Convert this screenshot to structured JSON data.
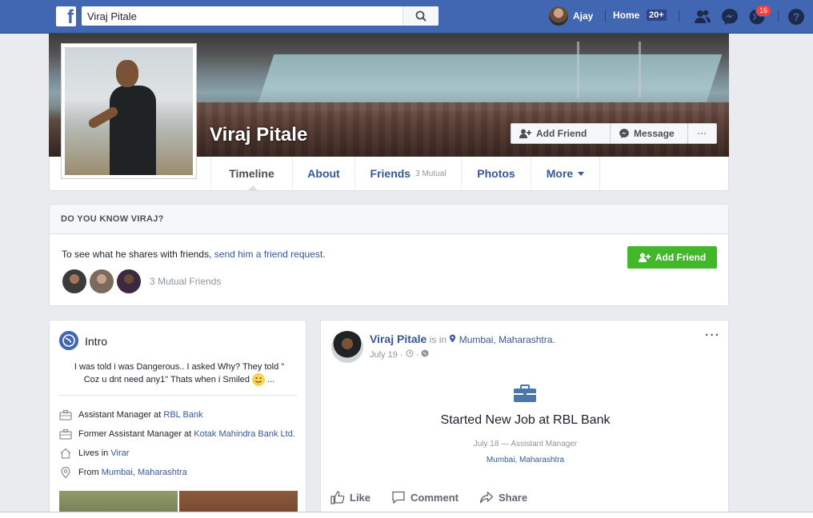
{
  "topbar": {
    "search_value": "Viraj Pitale",
    "user_name": "Ajay",
    "home_label": "Home",
    "home_count": "20+",
    "notifications_count": "16",
    "icons": [
      "facebook-logo-icon",
      "search-icon",
      "friend-requests-icon",
      "messenger-icon",
      "notifications-globe-icon",
      "help-icon"
    ]
  },
  "profile": {
    "name": "Viraj Pitale",
    "add_friend_label": "Add Friend",
    "message_label": "Message",
    "more_label": "···",
    "tabs": [
      {
        "label": "Timeline"
      },
      {
        "label": "About"
      },
      {
        "label": "Friends",
        "sub": "3 Mutual"
      },
      {
        "label": "Photos"
      },
      {
        "label": "More"
      }
    ]
  },
  "know": {
    "heading": "DO YOU KNOW VIRAJ?",
    "text": "To see what he shares with friends,",
    "link": "send him a friend request.",
    "button": "Add Friend",
    "mutual": "3 Mutual Friends"
  },
  "intro": {
    "title": "Intro",
    "bio": "I was told i was Dangerous.. I asked Why? They told \" Coz u dnt need any1\" Thats when i Smiled",
    "bio_suffix": "...",
    "items": [
      {
        "prefix": "Assistant Manager at ",
        "link": "RBL Bank",
        "icon": "briefcase-icon"
      },
      {
        "prefix": "Former Assistant Manager at ",
        "link": "Kotak Mahindra Bank Ltd.",
        "icon": "briefcase-icon"
      },
      {
        "prefix": "Lives in ",
        "link": "Virar",
        "icon": "home-icon"
      },
      {
        "prefix": "From ",
        "link": "Mumbai, Maharashtra",
        "icon": "location-pin-icon"
      }
    ]
  },
  "post": {
    "author": "Viraj Pitale",
    "is_in": "is in",
    "location": "Mumbai, Maharashtra.",
    "date": "July 19",
    "meta_sep": "·",
    "more": "···",
    "life_event_title": "Started New Job at RBL Bank",
    "life_event_sub": "July 18 — Assistant Manager",
    "life_event_loc": "Mumbai, Maharashtra",
    "actions": {
      "like": "Like",
      "comment": "Comment",
      "share": "Share"
    }
  },
  "colors": {
    "topbar": "#4267b2",
    "link": "#365899",
    "green": "#42b72a",
    "background": "#e9ebee"
  }
}
